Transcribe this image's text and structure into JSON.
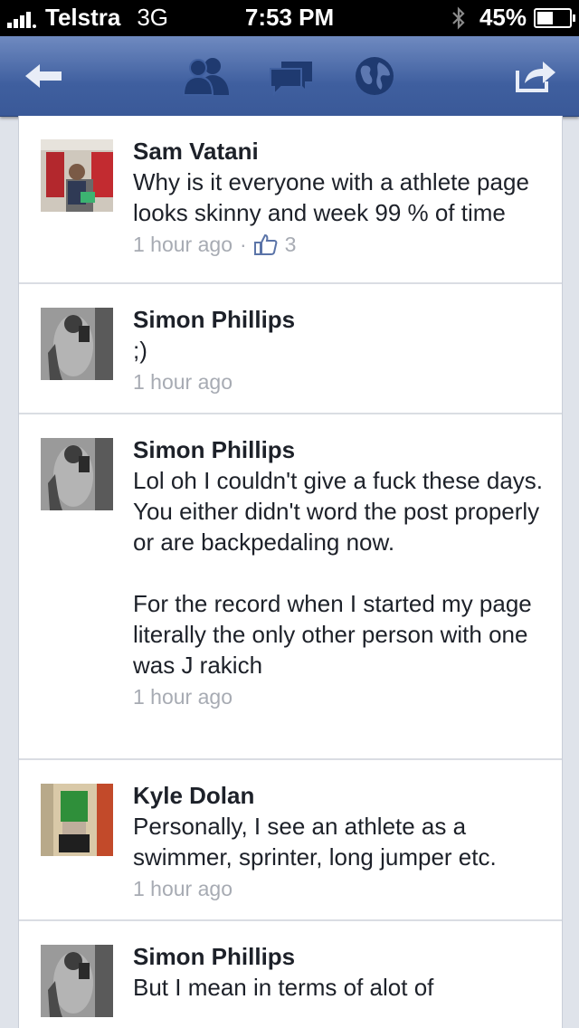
{
  "status_bar": {
    "carrier": "Telstra",
    "network": "3G",
    "time": "7:53 PM",
    "battery": "45%",
    "battery_level": 0.45
  },
  "nav_bar": {
    "icons": [
      "back-arrow-icon",
      "friends-icon",
      "messages-icon",
      "globe-icon",
      "share-icon"
    ]
  },
  "comments": [
    {
      "author": "Sam Vatani",
      "text": "Why is it everyone with a athlete page looks skinny and week 99 % of time",
      "time": "1 hour ago",
      "separator": "·",
      "likes": "3"
    },
    {
      "author": "Simon Phillips",
      "text": ";)",
      "time": "1 hour ago"
    },
    {
      "author": "Simon Phillips",
      "text": "Lol oh I couldn't give a fuck these days. You either didn't word the post properly or are backpedaling now.\n\nFor the record when I started my page literally the only other person with one was J rakich",
      "time": "1 hour ago"
    },
    {
      "author": "Kyle Dolan",
      "text": "Personally, I see an athlete as a swimmer, sprinter, long jumper etc.",
      "time": "1 hour ago"
    },
    {
      "author": "Simon Phillips",
      "text": "But I mean in terms of alot of",
      "time": ""
    }
  ]
}
